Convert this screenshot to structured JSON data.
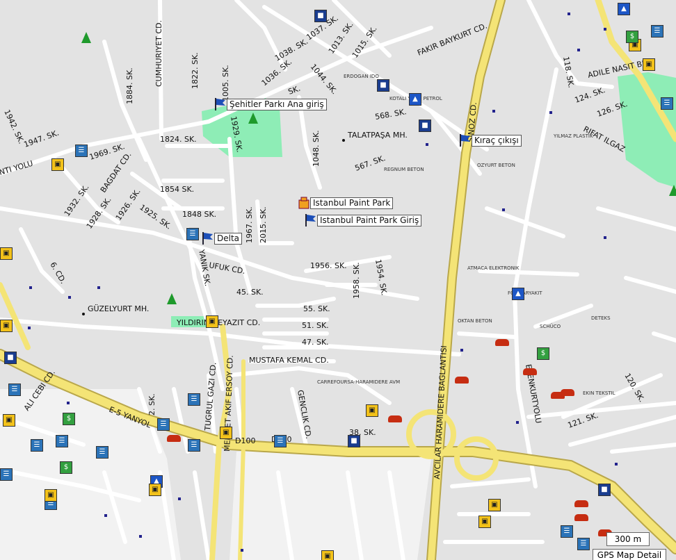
{
  "map": {
    "streets": [
      {
        "label": "CUMHURIYET CD."
      },
      {
        "label": "1884. SK."
      },
      {
        "label": "1822. SK."
      },
      {
        "label": "1005. SK."
      },
      {
        "label": "1038. SK."
      },
      {
        "label": "1037. SK."
      },
      {
        "label": "1013. SK."
      },
      {
        "label": "1015. SK."
      },
      {
        "label": "1036. SK."
      },
      {
        "label": "1044. SK."
      },
      {
        "label": "SK."
      },
      {
        "label": "FAKIR BAYKURT CD."
      },
      {
        "label": "118. SK."
      },
      {
        "label": "ADILE NASIT BLV."
      },
      {
        "label": "124. SK."
      },
      {
        "label": "126. SK."
      },
      {
        "label": "RIFAT ILGAZ"
      },
      {
        "label": "1942. SK."
      },
      {
        "label": "1947. SK."
      },
      {
        "label": "1969. SK."
      },
      {
        "label": "1824. SK."
      },
      {
        "label": "1929. SK."
      },
      {
        "label": "568. SK."
      },
      {
        "label": "1048. SK."
      },
      {
        "label": "567. SK."
      },
      {
        "label": "SINOZ CD."
      },
      {
        "label": "NTI YOLU"
      },
      {
        "label": "1932. SK."
      },
      {
        "label": "1928. SK."
      },
      {
        "label": "BAGDAT CD."
      },
      {
        "label": "1926. SK."
      },
      {
        "label": "1925. SK."
      },
      {
        "label": "1854 SK."
      },
      {
        "label": "1848 SK."
      },
      {
        "label": "1967. SK."
      },
      {
        "label": "2015. SK."
      },
      {
        "label": "6. CD."
      },
      {
        "label": "UFUK CD."
      },
      {
        "label": "1956. SK."
      },
      {
        "label": "1958. SK."
      },
      {
        "label": "1954. SK."
      },
      {
        "label": "YANIK SK."
      },
      {
        "label": "45. SK."
      },
      {
        "label": "55. SK."
      },
      {
        "label": "51. SK."
      },
      {
        "label": "47. SK."
      },
      {
        "label": "YILDIRIM BEYAZIT CD."
      },
      {
        "label": "MUSTAFA KEMAL CD."
      },
      {
        "label": "AVCILAR HARAMIDERE BAGLANTISI"
      },
      {
        "label": "ESENKURTYOLU"
      },
      {
        "label": "120. SK."
      },
      {
        "label": "121. SK."
      },
      {
        "label": "ALI CEBI CD."
      },
      {
        "label": "E-5 YANYOL"
      },
      {
        "label": "2. SK."
      },
      {
        "label": "TUGRUL GAZI CD."
      },
      {
        "label": "MEHMET AKIF ERSOY CD."
      },
      {
        "label": "GENCLIK CD."
      },
      {
        "label": "D100"
      },
      {
        "label": "D100"
      },
      {
        "label": "38. SK."
      }
    ],
    "areas": [
      {
        "label": "TALATPAŞA MH."
      },
      {
        "label": "GÜZELYURT MH."
      }
    ],
    "poi_labels": [
      {
        "label": "ERDOGAN IDO"
      },
      {
        "label": "KOTALI YIKICI PETROL"
      },
      {
        "label": "YILMAZ PLASTIK"
      },
      {
        "label": "REGNUM BETON"
      },
      {
        "label": "OZYURT BETON"
      },
      {
        "label": "ATMACA ELEKTRONIK"
      },
      {
        "label": "FG AKARYAKIT"
      },
      {
        "label": "OKTAN BETON"
      },
      {
        "label": "SCHÜCO"
      },
      {
        "label": "DETEKS"
      },
      {
        "label": "EKIN TEKSTIL"
      },
      {
        "label": "CARREFOURSA-HARAMIDERE AVM"
      }
    ],
    "callouts": [
      {
        "label": "Şehitler Parkı Ana giriş"
      },
      {
        "label": "Kıraç çıkışı"
      },
      {
        "label": "Istanbul Paint Park"
      },
      {
        "label": "Istanbul Paint Park Giriş"
      },
      {
        "label": "Delta"
      }
    ],
    "scale": "300 m",
    "detail_label": "GPS Map Detail",
    "colors": {
      "background": "#e3e3e3",
      "street": "#ffffff",
      "highway": "#f4e476",
      "park": "#8eedb6"
    }
  }
}
